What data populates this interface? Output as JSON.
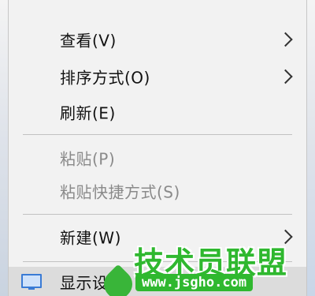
{
  "menu": {
    "items": [
      {
        "label": "查看(V)",
        "has_submenu": true,
        "enabled": true
      },
      {
        "label": "排序方式(O)",
        "has_submenu": true,
        "enabled": true
      },
      {
        "label": "刷新(E)",
        "has_submenu": false,
        "enabled": true
      },
      {
        "label": "粘贴(P)",
        "has_submenu": false,
        "enabled": false
      },
      {
        "label": "粘贴快捷方式(S)",
        "has_submenu": false,
        "enabled": false
      },
      {
        "label": "新建(W)",
        "has_submenu": true,
        "enabled": true
      },
      {
        "label": "显示设",
        "has_submenu": false,
        "enabled": true,
        "icon": "display-icon",
        "partially_covered": true
      }
    ]
  },
  "watermark": {
    "title": "技术员联盟",
    "url": "www.jsgho.com",
    "color": "#2fb82f"
  }
}
